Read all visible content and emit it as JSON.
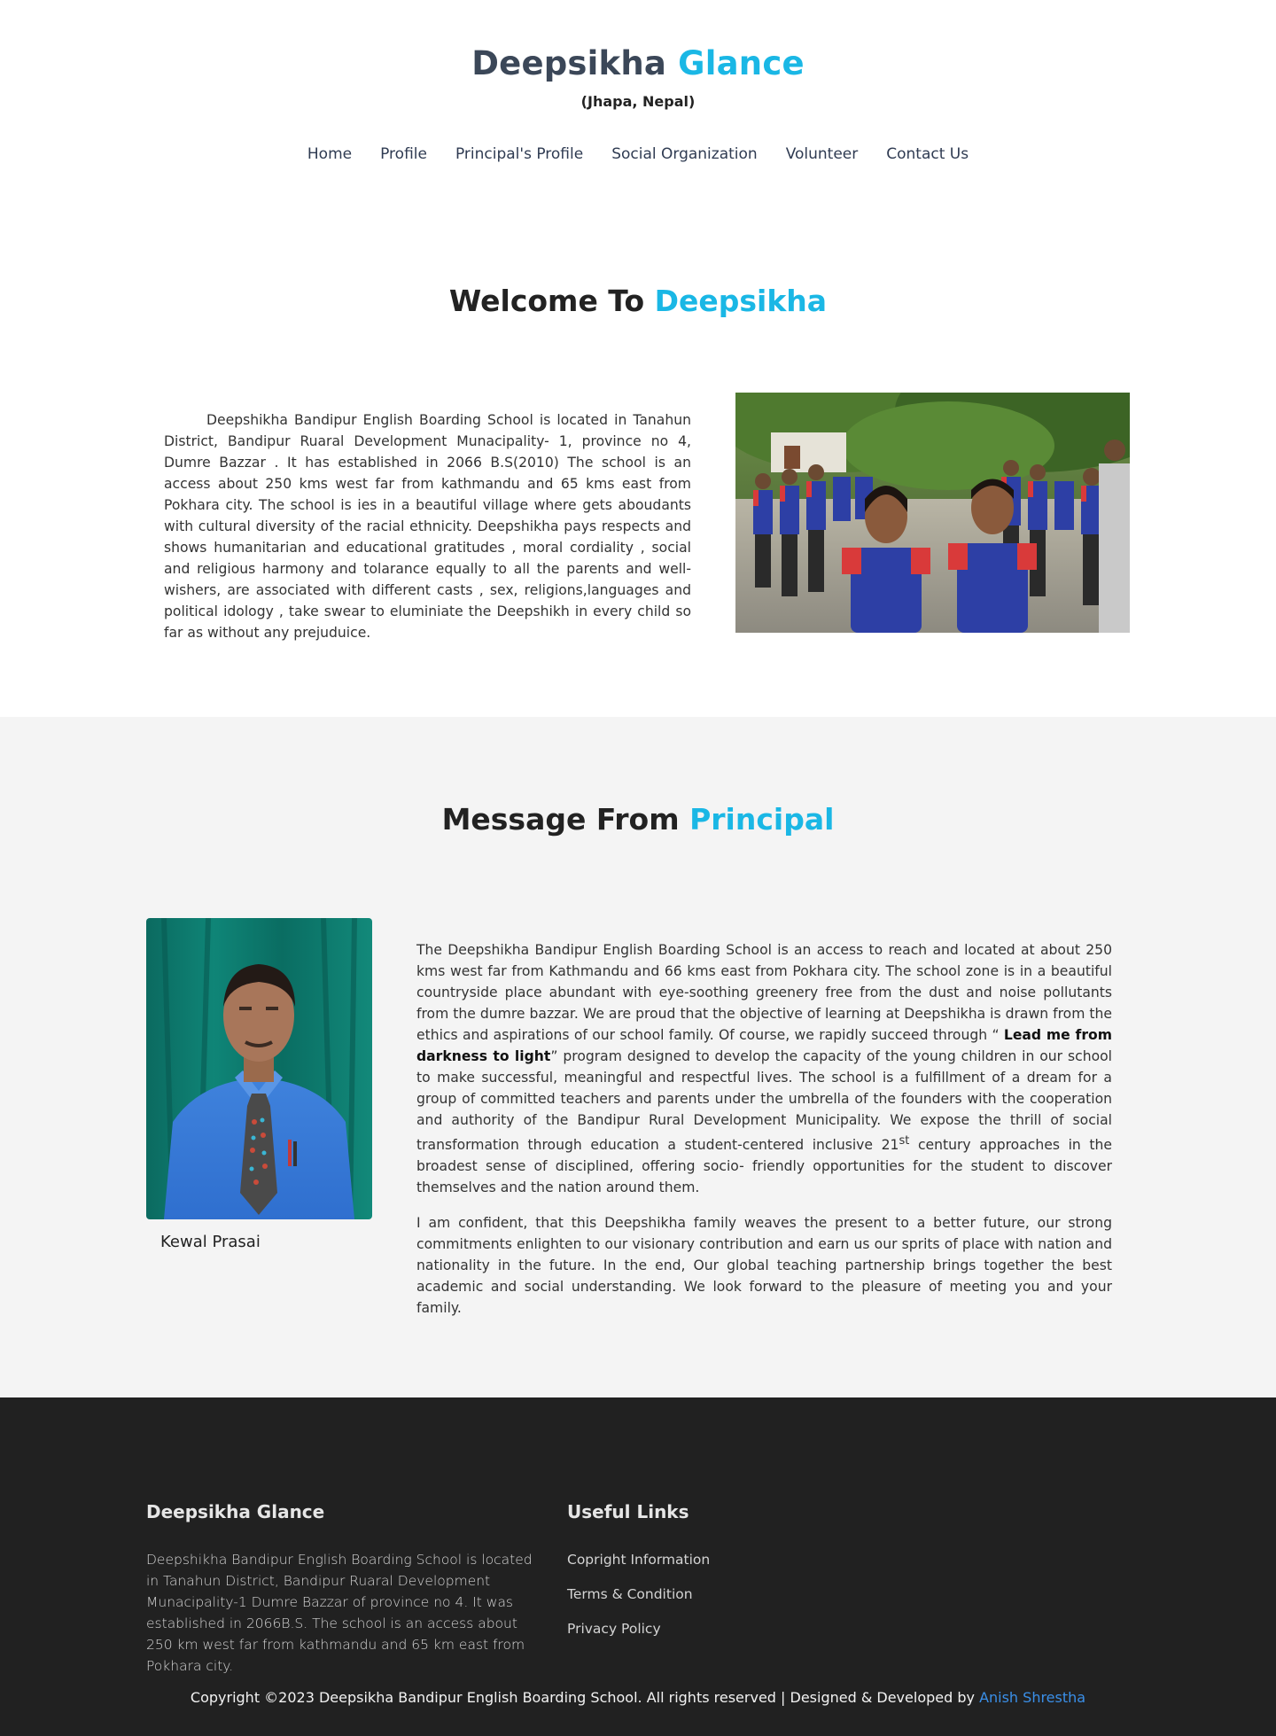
{
  "header": {
    "brand_part1": "Deepsikha",
    "brand_part2": "Glance",
    "location": "(Jhapa, Nepal)"
  },
  "nav": {
    "items": [
      "Home",
      "Profile",
      "Principal's Profile",
      "Social Organization",
      "Volunteer",
      "Contact Us"
    ]
  },
  "welcome": {
    "title_part1": "Welcome To",
    "title_part2": "Deepsikha",
    "text": "Deepshikha Bandipur English Boarding School is located  in Tanahun District, Bandipur Ruaral Development Munacipality- 1, province no 4, Dumre Bazzar  . It has established in 2066 B.S(2010) The school is an access about 250 kms west far from kathmandu and 65 kms east from Pokhara city. The school is ies in a beautiful  village where gets aboudants with  cultural diversity of the racial ethnicity.  Deepshikha pays respects and shows  humanitarian and educational  gratitudes , moral cordiality , social and religious harmony and tolarance equally to all  the parents and well-wishers, are associated with different casts , sex, religions,languages and political idology , take swear to eluminiate the Deepshikh in every child so far as  without any prejuduice."
  },
  "principal": {
    "title_part1": "Message From",
    "title_part2": "Principal",
    "name": "Kewal Prasai",
    "para1_a": "The Deepshikha  Bandipur English Boarding School is an access to reach and located at about 250  kms west far from Kathmandu and 66 kms east from Pokhara city. The school zone is in a beautiful countryside place abundant with eye-soothing greenery free from the dust and noise pollutants from the dumre bazzar. We are proud that the objective of learning at Deepshikha is drawn from the ethics and aspirations of our school family. Of course, we rapidly succeed through  “ ",
    "para1_bold": "Lead me from darkness to light",
    "para1_b": "” program designed to develop the capacity of the young children in our school to make successful, meaningful and respectful lives. The school is a fulfillment of a dream for a group of committed teachers and parents under the umbrella of the founders with the cooperation and authority of the Bandipur Rural Development  Municipality. We expose the thrill of social transformation through education a student-centered inclusive 21",
    "para1_sup": "st",
    "para1_c": " century approaches in the broadest sense of disciplined, offering  socio- friendly opportunities for the student  to discover themselves and the nation around them.",
    "para2": "I am confident, that this Deepshikha family weaves the present to a better future, our strong commitments enlighten to our visionary contribution and earn us our sprits of place with nation and nationality in the future.  In the end,  Our global teaching partnership brings together the best academic and social understanding. We look forward to the pleasure of meeting you and your family."
  },
  "footer": {
    "about_title": "Deepsikha Glance",
    "about_text": "Deepshikha Bandipur English Boarding School is located in Tanahun District, Bandipur Ruaral Development Munacipality-1 Dumre Bazzar of province no 4. It was established in 2066B.S. The school is an access about 250 km west far from kathmandu and 65 km east from Pokhara city.",
    "links_title": "Useful Links",
    "links": [
      "Copright Information",
      "Terms & Condition",
      "Privacy Policy"
    ],
    "copyright": "Copyright ©2023 Deepsikha Bandipur English Boarding School. All rights reserved | Designed & Developed by ",
    "developer": "Anish Shrestha"
  },
  "colors": {
    "accent": "#1ab7e5",
    "footer_bg": "#212121",
    "section_bg": "#f4f4f4"
  }
}
